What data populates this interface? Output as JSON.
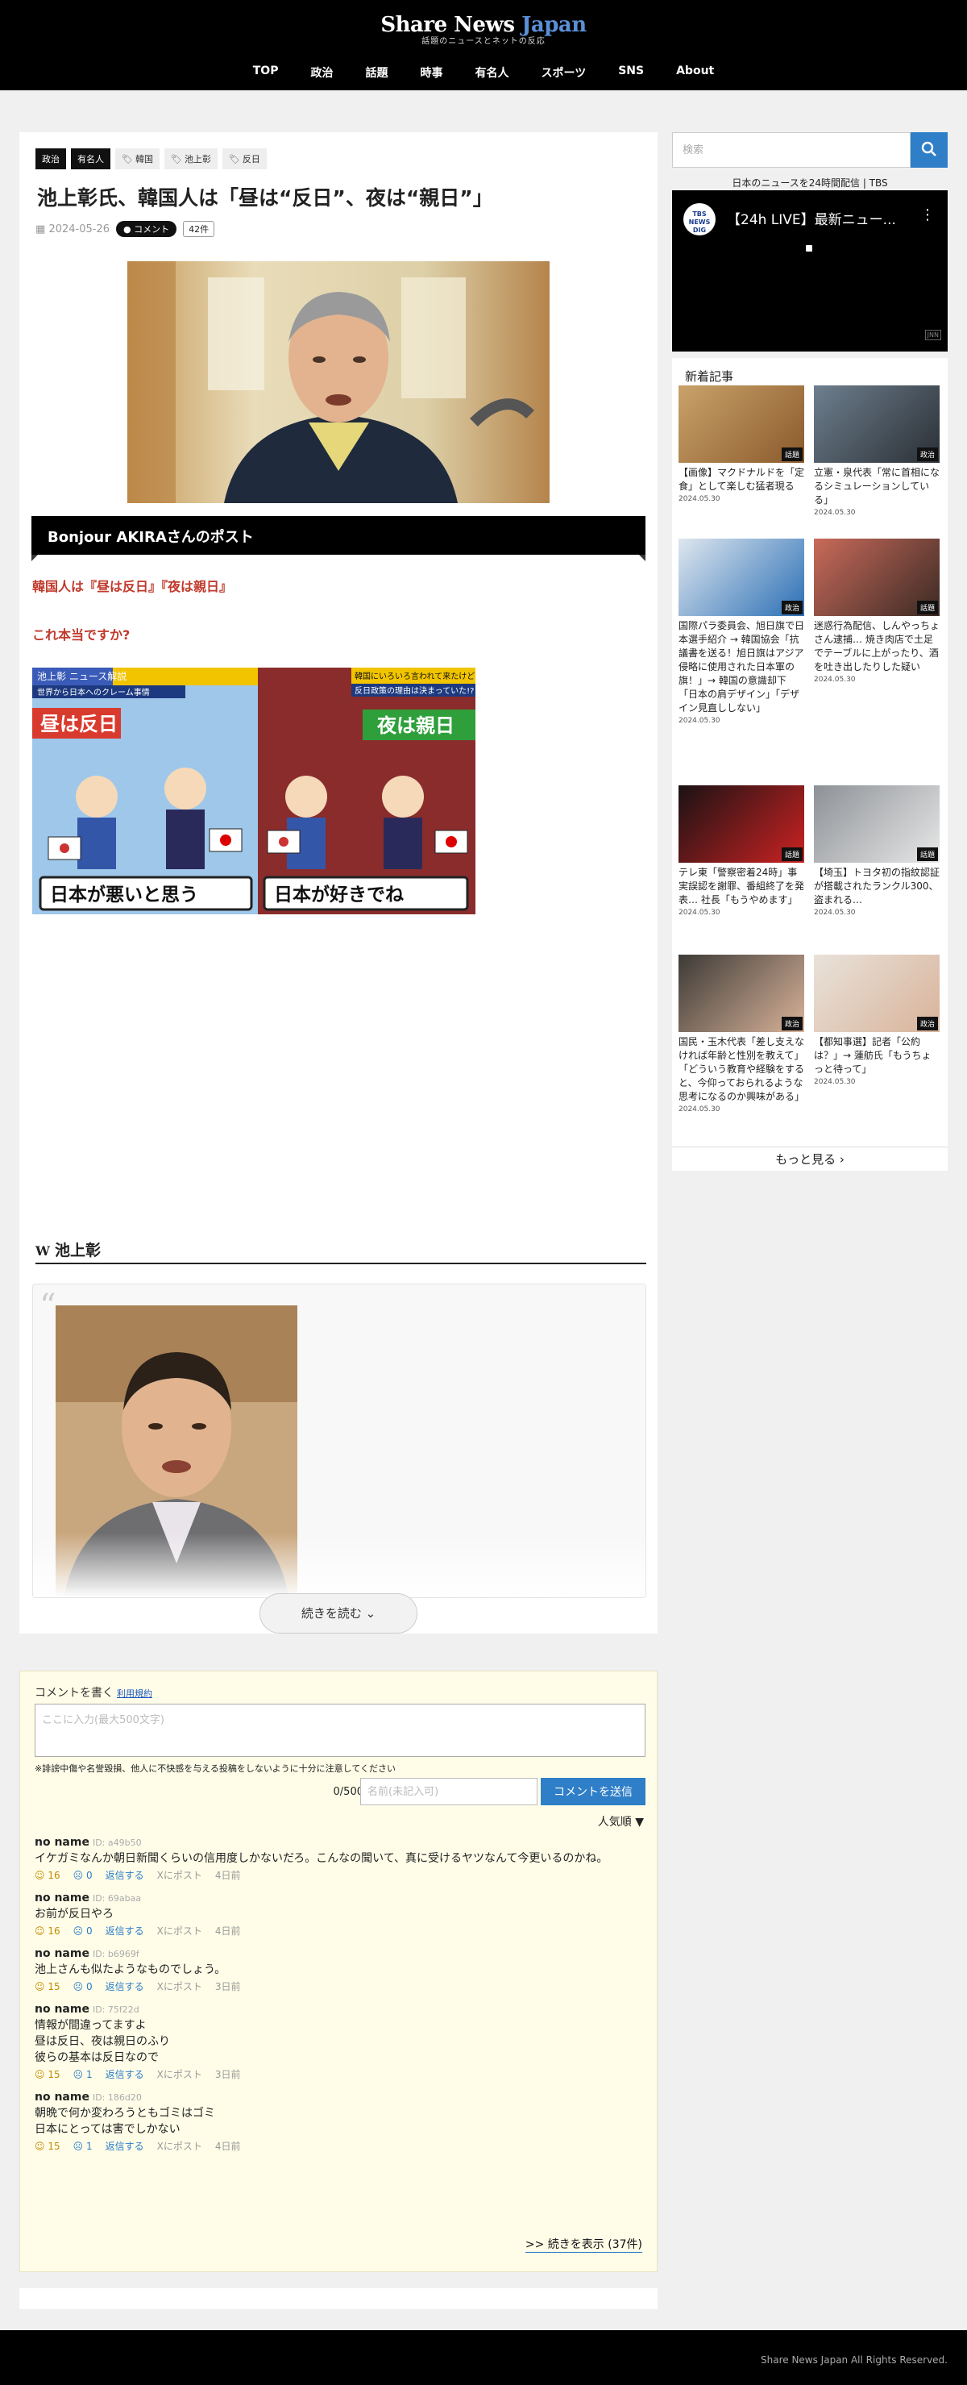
{
  "site": {
    "logo_main": "Share News",
    "logo_accent": "Japan",
    "logo_sub": "話題のニュースとネットの反応"
  },
  "nav": [
    "TOP",
    "政治",
    "話題",
    "時事",
    "有名人",
    "スポーツ",
    "SNS",
    "About"
  ],
  "article": {
    "categories": [
      "政治",
      "有名人"
    ],
    "tags": [
      "韓国",
      "池上彰",
      "反日"
    ],
    "title": "池上彰氏、韓国人は「昼は“反日”、夜は“親日”」",
    "date": "2024-05-26",
    "comment_badge": "コメント",
    "comment_count": "42件",
    "post_banner": "Bonjour AKIRAさんのポスト",
    "red_line_1": "韓国人は『昼は反日』『夜は親日』",
    "red_line_2": "これ本当ですか?",
    "illustration": {
      "top_left": "池上彰 ニュース解説",
      "sub_left": "世界から日本へのクレーム事情",
      "left_banner": "昼は反日",
      "left_bottom": "日本が悪いと思う",
      "top_right": "韓国にいろいろ言われて来たけど",
      "sub_right": "反日政策の理由は決まっていた!?",
      "right_banner": "夜は親日",
      "right_bottom": "日本が好きでね"
    },
    "wiki_heading": "池上彰",
    "wiki_mark": "W",
    "read_more": "続きを読む ⌄"
  },
  "comments": {
    "heading": "コメントを書く",
    "terms_link": "利用規約",
    "textarea_placeholder": "ここに入力(最大500文字)",
    "warning": "※誹謗中傷や名誉毀損、他人に不快感を与える投稿をしないように十分に注意してください",
    "char_count": "0/500",
    "name_placeholder": "名前(未記入可)",
    "submit_label": "コメントを送信",
    "sort_label": "人気順 ▼",
    "reply_label": "返信する",
    "xpost_label": "Xにポスト",
    "items": [
      {
        "author": "no name",
        "id": "ID: a49b50",
        "body": "イケガミなんか朝日新聞くらいの信用度しかないだろ。こんなの聞いて、真に受けるヤツなんて今更いるのかね。",
        "up": "16",
        "down": "0",
        "time": "4日前"
      },
      {
        "author": "no name",
        "id": "ID: 69abaa",
        "body": "お前が反日やろ",
        "up": "16",
        "down": "0",
        "time": "4日前"
      },
      {
        "author": "no name",
        "id": "ID: b6969f",
        "body": "池上さんも似たようなものでしょう。",
        "up": "15",
        "down": "0",
        "time": "3日前"
      },
      {
        "author": "no name",
        "id": "ID: 75f22d",
        "body": "情報が間違ってますよ\n昼は反日、夜は親日のふり\n彼らの基本は反日なので",
        "up": "15",
        "down": "1",
        "time": "3日前"
      },
      {
        "author": "no name",
        "id": "ID: 186d20",
        "body": "朝晩で何か変わろうともゴミはゴミ\n日本にとっては害でしかない",
        "up": "15",
        "down": "1",
        "time": "4日前"
      }
    ],
    "show_more": ">> 続きを表示 (37件)"
  },
  "sidebar": {
    "search_placeholder": "検索",
    "yt_label": "日本のニュースを24時間配信 | TBS",
    "yt_title": "【24h LIVE】最新ニュー...",
    "yt_logo": "TBS NEWS DIG",
    "yt_brand": "JNN",
    "new_heading": "新着記事",
    "more_label": "もっと見る ›",
    "articles": [
      {
        "tag": "話題",
        "title": "【画像】マクドナルドを「定食」として楽しむ猛者現る",
        "date": "2024.05.30"
      },
      {
        "tag": "政治",
        "title": "立憲・泉代表「常に首相になるシミュレーションしている」",
        "date": "2024.05.30"
      },
      {
        "tag": "政治",
        "title": "国際パラ委員会、旭日旗で日本選手紹介 → 韓国協会「抗議書を送る！旭日旗はアジア侵略に使用された日本軍の旗！」→ 韓国の意識却下「日本の肩デザイン」「デザイン見直ししない」",
        "date": "2024.05.30"
      },
      {
        "tag": "話題",
        "title": "迷惑行為配信、しんやっちょさん逮捕… 焼き肉店で土足でテーブルに上がったり、酒を吐き出したりした疑い",
        "date": "2024.05.30"
      },
      {
        "tag": "話題",
        "title": "テレ東「警察密着24時」事実誤認を謝罪、番組終了を発表… 社長「もうやめます」",
        "date": "2024.05.30"
      },
      {
        "tag": "話題",
        "title": "【埼玉】トヨタ初の指紋認証が搭載されたランクル300、盗まれる…",
        "date": "2024.05.30"
      },
      {
        "tag": "政治",
        "title": "国民・玉木代表「差し支えなければ年齢と性別を教えて」「どういう教育や経験をすると、今仰っておられるような思考になるのか興味がある」",
        "date": "2024.05.30"
      },
      {
        "tag": "政治",
        "title": "【都知事選】記者「公約は？」→ 蓮舫氏「もうちょっと待って」",
        "date": "2024.05.30"
      }
    ]
  },
  "footer": "Share News Japan All Rights Reserved."
}
